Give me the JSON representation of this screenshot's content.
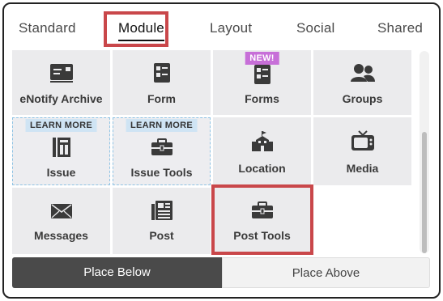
{
  "tabs": [
    {
      "label": "Standard",
      "active": false
    },
    {
      "label": "Module",
      "active": true
    },
    {
      "label": "Layout",
      "active": false
    },
    {
      "label": "Social",
      "active": false
    },
    {
      "label": "Shared",
      "active": false
    }
  ],
  "tiles": [
    {
      "label": "eNotify Archive",
      "icon": "enotify-archive-icon",
      "badge": ""
    },
    {
      "label": "Form",
      "icon": "form-icon",
      "badge": ""
    },
    {
      "label": "Forms",
      "icon": "forms-icon",
      "badge": "NEW!"
    },
    {
      "label": "Groups",
      "icon": "groups-icon",
      "badge": ""
    },
    {
      "label": "Issue",
      "icon": "issue-icon",
      "badge": "LEARN MORE"
    },
    {
      "label": "Issue Tools",
      "icon": "briefcase-icon",
      "badge": "LEARN MORE"
    },
    {
      "label": "Location",
      "icon": "school-building-icon",
      "badge": ""
    },
    {
      "label": "Media",
      "icon": "tv-icon",
      "badge": ""
    },
    {
      "label": "Messages",
      "icon": "envelope-icon",
      "badge": ""
    },
    {
      "label": "Post",
      "icon": "newspaper-icon",
      "badge": ""
    },
    {
      "label": "Post Tools",
      "icon": "briefcase-icon",
      "badge": ""
    }
  ],
  "actions": {
    "place_below": "Place Below",
    "place_above": "Place Above"
  },
  "colors": {
    "highlight": "#c9474a",
    "new_badge": "#c76fd8",
    "learn_badge": "#cfe4f4",
    "tile_bg": "#ebebed",
    "active_action": "#4a4a4a"
  }
}
